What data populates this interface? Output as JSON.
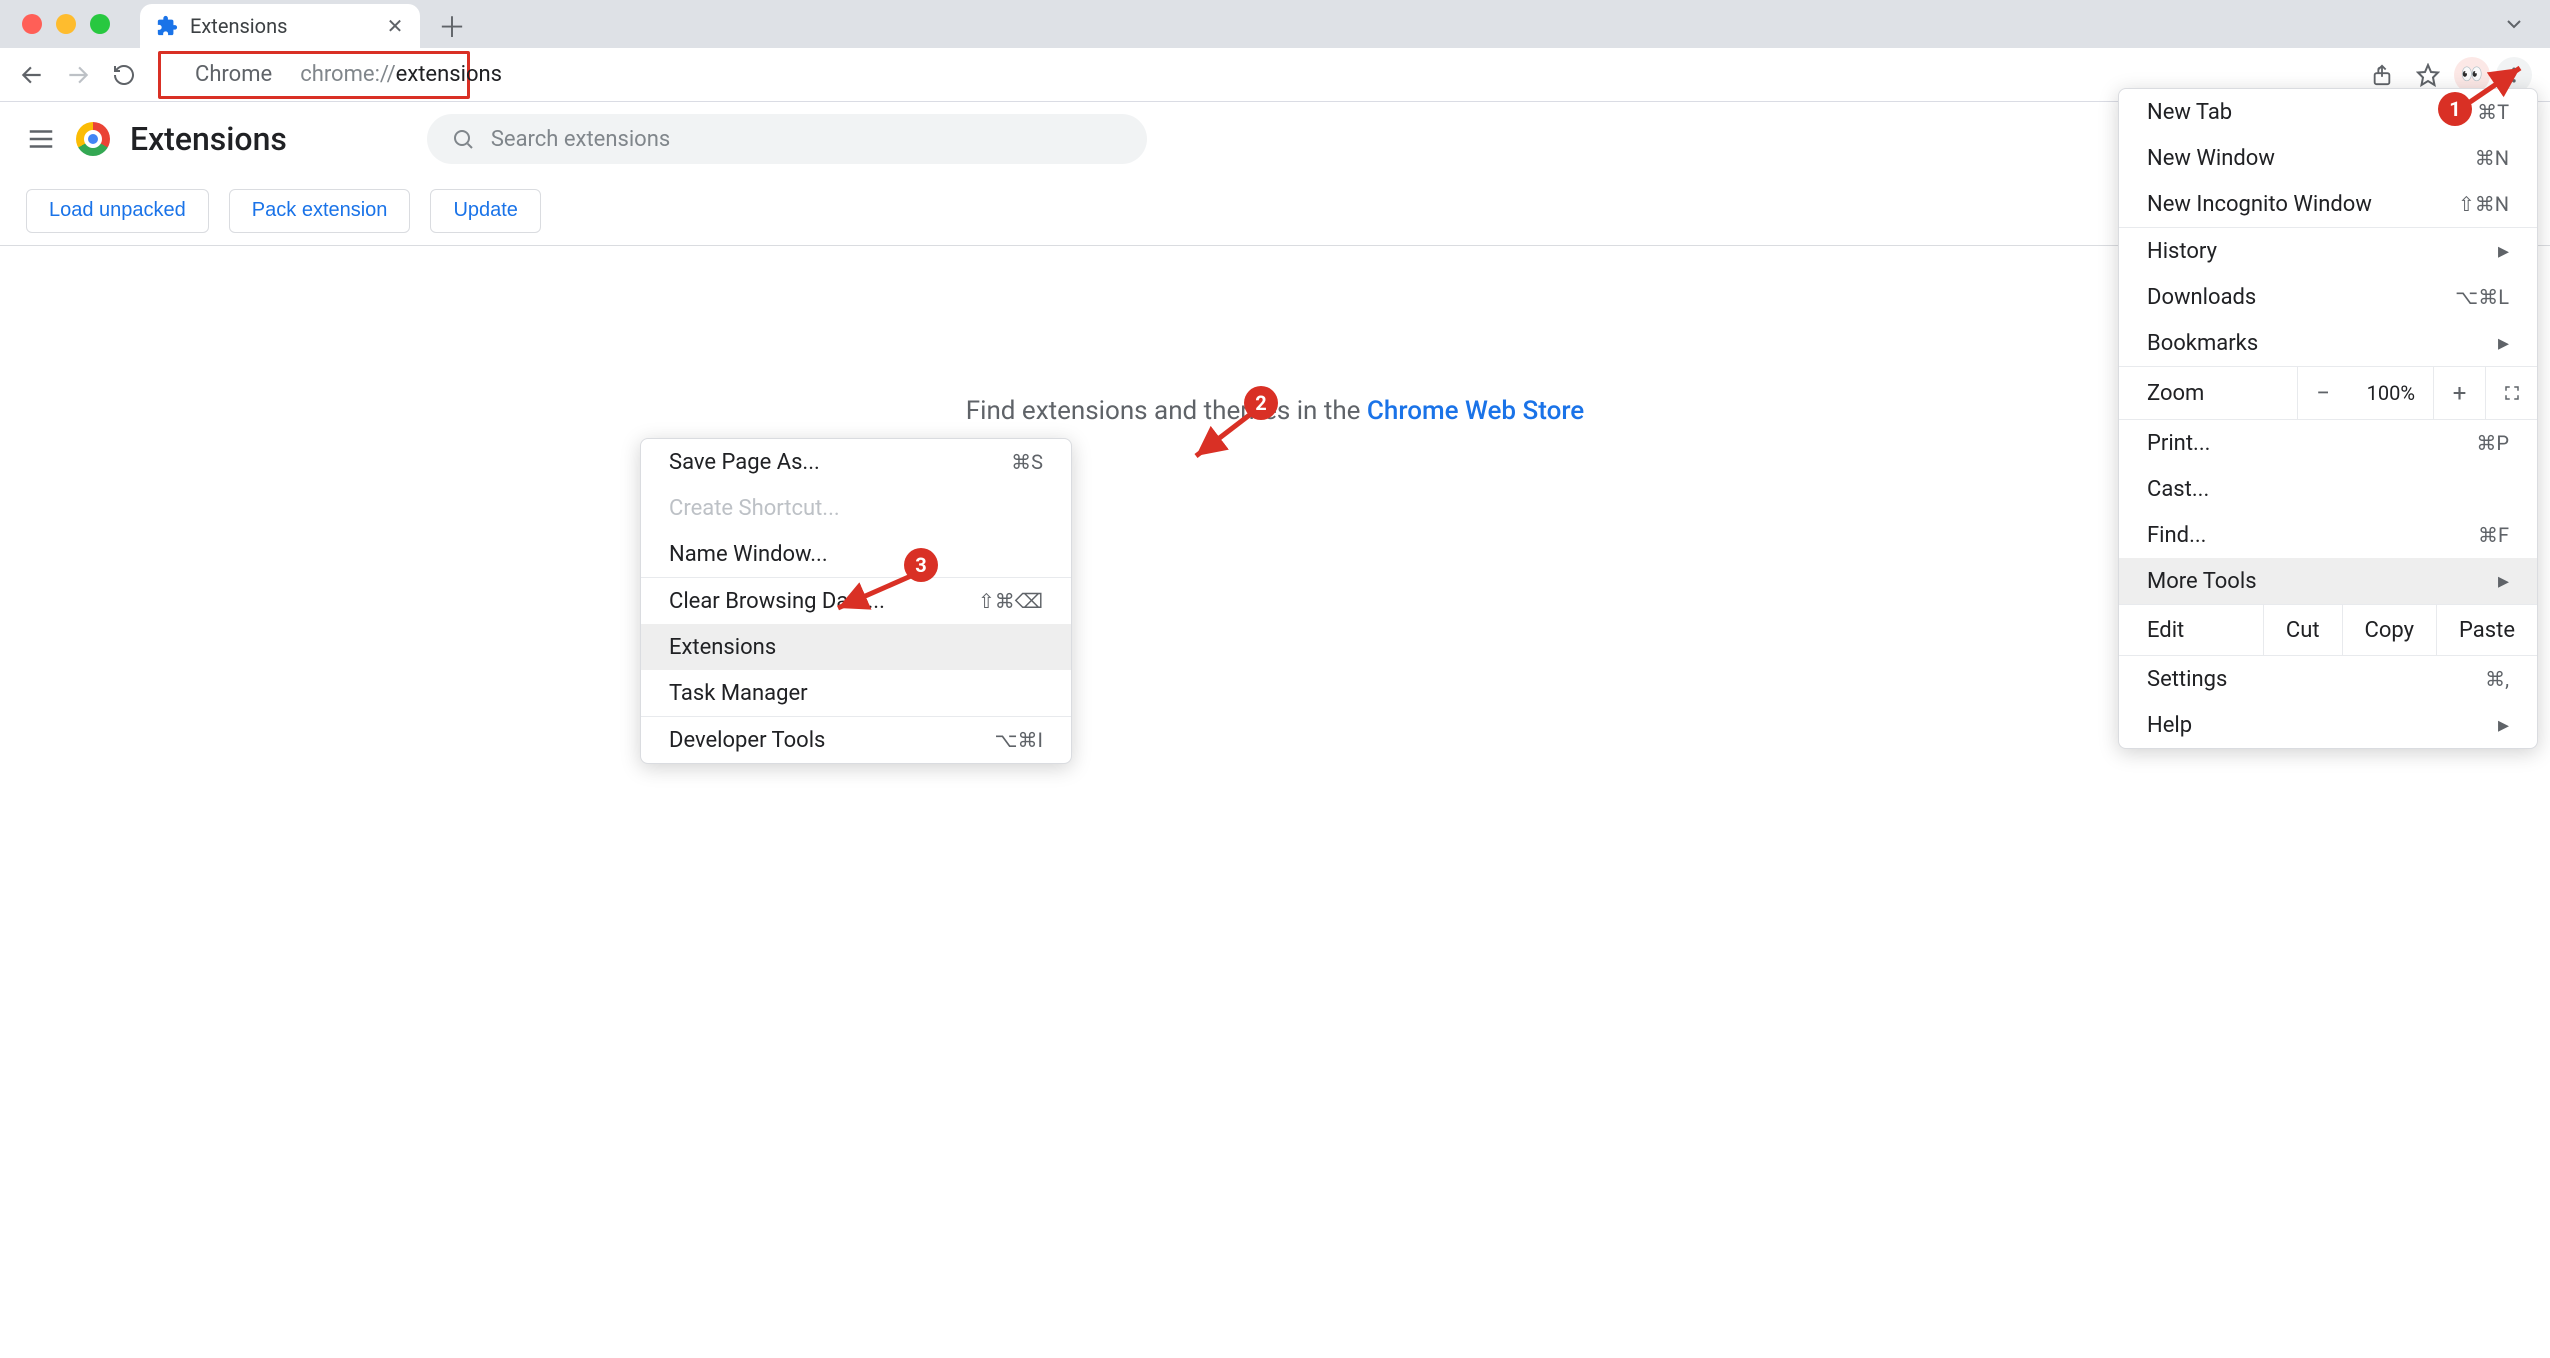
{
  "tab": {
    "title": "Extensions"
  },
  "omnibox": {
    "label": "Chrome",
    "prefix": "chrome://",
    "path": "extensions"
  },
  "appbar": {
    "title": "Extensions",
    "search_placeholder": "Search extensions"
  },
  "actions": {
    "load_unpacked": "Load unpacked",
    "pack": "Pack extension",
    "update": "Update"
  },
  "main": {
    "hint_pre": "Find extensions and themes in the ",
    "hint_link": "Chrome Web Store"
  },
  "menu": {
    "new_tab": "New Tab",
    "new_tab_sc": "⌘T",
    "new_window": "New Window",
    "new_window_sc": "⌘N",
    "incognito": "New Incognito Window",
    "incognito_sc": "⇧⌘N",
    "history": "History",
    "downloads": "Downloads",
    "downloads_sc": "⌥⌘L",
    "bookmarks": "Bookmarks",
    "zoom_label": "Zoom",
    "zoom_value": "100%",
    "print": "Print...",
    "print_sc": "⌘P",
    "cast": "Cast...",
    "find": "Find...",
    "find_sc": "⌘F",
    "more_tools": "More Tools",
    "edit": "Edit",
    "cut": "Cut",
    "copy": "Copy",
    "paste": "Paste",
    "settings": "Settings",
    "settings_sc": "⌘,",
    "help": "Help"
  },
  "submenu": {
    "save_as": "Save Page As...",
    "save_as_sc": "⌘S",
    "create_shortcut": "Create Shortcut...",
    "name_window": "Name Window...",
    "clear_data": "Clear Browsing Data...",
    "clear_data_sc": "⇧⌘⌫",
    "extensions": "Extensions",
    "task_manager": "Task Manager",
    "dev_tools": "Developer Tools",
    "dev_tools_sc": "⌥⌘I"
  },
  "annotations": {
    "b1": "1",
    "b2": "2",
    "b3": "3"
  }
}
